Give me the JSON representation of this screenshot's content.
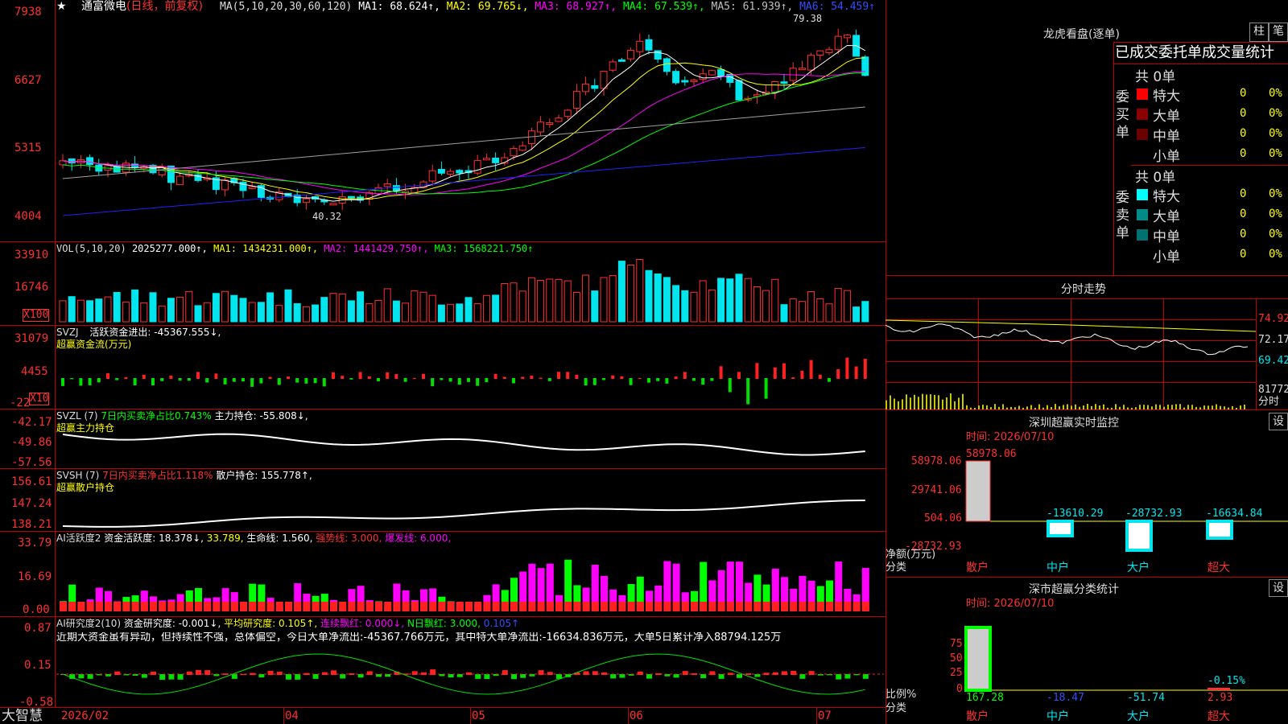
{
  "colors": {
    "up": "#ff3030",
    "down": "#00e5ee",
    "ma1": "#ffffff",
    "ma2": "#ffff00",
    "ma3": "#ff00ff",
    "ma4": "#00ff00",
    "ma5": "#a0a0a0",
    "ma6": "#2020ff",
    "grid": "#c00000"
  },
  "main": {
    "header_star": "★",
    "stock_name": "通富微电",
    "period": "(日线，前复权)",
    "ma_params": "MA(5,10,20,30,60,120)",
    "ma1": "MA1: 68.624↑,",
    "ma2": "MA2: 69.765↓,",
    "ma3": "MA3: 68.927↑,",
    "ma4": "MA4: 67.539↑,",
    "ma5": "MA5: 61.939↑,",
    "ma6": "MA6: 54.459↑",
    "high_label": "79.38",
    "low_label": "40.32",
    "y_ticks": [
      "7938",
      "6627",
      "5315",
      "4004"
    ],
    "x_labels": [
      "2026/02",
      "04",
      "05",
      "06",
      "07"
    ]
  },
  "vol": {
    "title": "VOL(5,10,20)",
    "value": "2025277.000↑,",
    "ma1": "MA1: 1434231.000↑,",
    "ma2": "MA2: 1441429.750↑,",
    "ma3": "MA3: 1568221.750↑",
    "y_ticks": [
      "33910",
      "16746"
    ],
    "unit": "X100"
  },
  "svzj": {
    "title": "SVZJ",
    "desc": "活跃资金进出: -45367.555↓,",
    "sub": "超赢资金流(万元)",
    "y_ticks": [
      "31079",
      "4455",
      "-22"
    ],
    "unit": "X10"
  },
  "svzl": {
    "title": "SVZL (7)",
    "desc1": "7日内买卖净占比0.743%",
    "desc2": "主力持仓: -55.808↓,",
    "sub": "超赢主力持仓",
    "y_ticks": [
      "-42.17",
      "-49.86",
      "-57.56"
    ]
  },
  "svsh": {
    "title": "SVSH (7)",
    "desc1": "7日内买卖净占比1.118%",
    "desc2": "散户持仓: 155.778↑,",
    "sub": "超赢散户持仓",
    "y_ticks": [
      "156.61",
      "147.24",
      "138.21"
    ]
  },
  "ai1": {
    "title": "AI活跃度2",
    "d1": "资金活跃度: 18.378↓,",
    "d2": "33.789,",
    "d3": "生命线: 1.560,",
    "d4": "强势线: 3.000,",
    "d5": "爆发线: 6.000,",
    "y_ticks": [
      "33.79",
      "16.69",
      "0.00"
    ]
  },
  "ai2": {
    "title": "AI研究度2(10)",
    "d1": "资金研究度: -0.001↓,",
    "d2": "平均研究度: 0.105↑,",
    "d3": "连续飘红: 0.000↓,",
    "d4": "N日飘红: 3.000,",
    "d5": "0.105↑",
    "comment": "近期大资金虽有异动，但持续性不强，总体偏空，今日大单净流出:-45367.766万元，其中特大单净流出:-16634.836万元，大单5日累计净入88794.125万",
    "y_ticks": [
      "0.87",
      "0.15",
      "-0.58"
    ]
  },
  "footer": {
    "brand": "大智慧"
  },
  "right": {
    "dragon_title": "龙虎看盘(逐单)",
    "btn1": "柱",
    "btn2": "笔",
    "tabs_title": "已成交委托单成交量统计",
    "buy": {
      "total": "共 0单",
      "side": "委买单",
      "rows": [
        {
          "label": "特大",
          "count": "0",
          "pct": "0%",
          "color": "#ff0000"
        },
        {
          "label": "大单",
          "count": "0",
          "pct": "0%",
          "color": "#8b0000"
        },
        {
          "label": "中单",
          "count": "0",
          "pct": "0%",
          "color": "#6a0000"
        },
        {
          "label": "小单",
          "count": "0",
          "pct": "0%",
          "color": ""
        }
      ]
    },
    "sell": {
      "total": "共 0单",
      "side": "委卖单",
      "rows": [
        {
          "label": "特大",
          "count": "0",
          "pct": "0%",
          "color": "#00ffff"
        },
        {
          "label": "大单",
          "count": "0",
          "pct": "0%",
          "color": "#008b8b"
        },
        {
          "label": "中单",
          "count": "0",
          "pct": "0%",
          "color": "#007070"
        },
        {
          "label": "小单",
          "count": "0",
          "pct": "0%",
          "color": ""
        }
      ]
    },
    "intraday_title": "分时走势",
    "intraday_y": [
      "74.92",
      "72.17",
      "69.42"
    ],
    "intraday_vol": "81772",
    "intraday_unit": "分时",
    "monitor_title": "深圳超赢实时监控",
    "set_label": "设",
    "monitor_time": "时间: 2026/07/10",
    "monitor_y": [
      "58978.06",
      "29741.06",
      "504.06",
      "-28732.93"
    ],
    "monitor_vals": [
      "58978.06",
      "-13610.29",
      "-28732.93",
      "-16634.84"
    ],
    "monitor_unit": "净额(万元)",
    "monitor_cat": "分类",
    "categories": [
      "散户",
      "中户",
      "大户",
      "超大"
    ],
    "stats_title": "深市超赢分类统计",
    "stats_time": "时间: 2026/07/10",
    "stats_y": [
      "75",
      "50",
      "25",
      "0"
    ],
    "stats_vals": [
      "167.28",
      "-18.47",
      "-51.74",
      "2.93"
    ],
    "stats_extra": "-0.15%",
    "stats_unit": "比例%",
    "stats_cat": "分类"
  }
}
